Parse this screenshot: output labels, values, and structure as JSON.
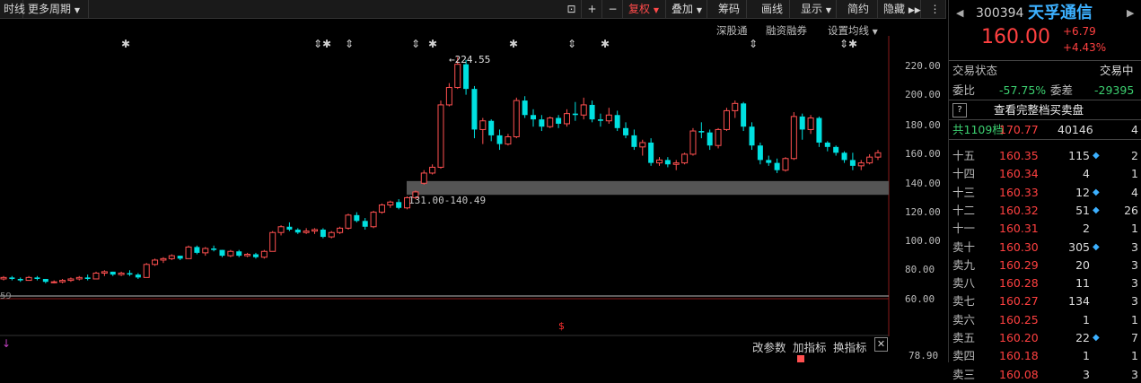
{
  "toolbar": {
    "period_partial": "时线",
    "more_periods": "更多周期",
    "adjust": "复权",
    "overlay": "叠加",
    "chips": "筹码",
    "draw_line": "画线",
    "display": "显示",
    "simple": "简约",
    "hide": "隐藏"
  },
  "subnav": {
    "sz_connect": "深股通",
    "margin": "融资融券",
    "ma_settings": "设置均线"
  },
  "chart": {
    "peak_label": "224.55",
    "band_label": "131.00-140.49",
    "y_ticks": [
      "220.00",
      "200.00",
      "180.00",
      "160.00",
      "140.00",
      "120.00",
      "100.00",
      "80.00",
      "60.00"
    ],
    "bottom_value": "78.90",
    "left_edge_value": "59"
  },
  "chart_data": {
    "type": "candlestick",
    "ylim": [
      55,
      232
    ],
    "support_band": [
      131.0,
      140.49
    ],
    "candles": [
      [
        73,
        75,
        72,
        74
      ],
      [
        74,
        75,
        72,
        73
      ],
      [
        73,
        74,
        71,
        72
      ],
      [
        72,
        75,
        72,
        74
      ],
      [
        74,
        75,
        72,
        73
      ],
      [
        73,
        73,
        70,
        71
      ],
      [
        71,
        72,
        70,
        71
      ],
      [
        71,
        73,
        70,
        72
      ],
      [
        72,
        74,
        71,
        73
      ],
      [
        73,
        75,
        72,
        74
      ],
      [
        74,
        76,
        72,
        73
      ],
      [
        73,
        78,
        73,
        77
      ],
      [
        77,
        79,
        75,
        78
      ],
      [
        78,
        78,
        75,
        76
      ],
      [
        76,
        78,
        75,
        77
      ],
      [
        77,
        79,
        75,
        76
      ],
      [
        76,
        77,
        73,
        74
      ],
      [
        74,
        84,
        74,
        83
      ],
      [
        83,
        87,
        82,
        86
      ],
      [
        86,
        88,
        84,
        87
      ],
      [
        87,
        90,
        86,
        89
      ],
      [
        89,
        89,
        86,
        87
      ],
      [
        87,
        96,
        87,
        95
      ],
      [
        95,
        96,
        90,
        91
      ],
      [
        91,
        95,
        89,
        94
      ],
      [
        94,
        96,
        92,
        93
      ],
      [
        93,
        93,
        88,
        89
      ],
      [
        89,
        93,
        88,
        92
      ],
      [
        92,
        93,
        88,
        89
      ],
      [
        89,
        91,
        88,
        90
      ],
      [
        90,
        91,
        87,
        88
      ],
      [
        88,
        93,
        87,
        92
      ],
      [
        92,
        106,
        92,
        105
      ],
      [
        105,
        110,
        103,
        109
      ],
      [
        109,
        112,
        106,
        107
      ],
      [
        107,
        108,
        104,
        105
      ],
      [
        105,
        108,
        104,
        106
      ],
      [
        106,
        108,
        104,
        107
      ],
      [
        107,
        108,
        101,
        102
      ],
      [
        102,
        106,
        101,
        105
      ],
      [
        105,
        109,
        104,
        108
      ],
      [
        108,
        118,
        107,
        117
      ],
      [
        117,
        119,
        112,
        113
      ],
      [
        113,
        115,
        107,
        109
      ],
      [
        109,
        120,
        108,
        119
      ],
      [
        119,
        125,
        118,
        124
      ],
      [
        124,
        127,
        122,
        126
      ],
      [
        126,
        128,
        121,
        122
      ],
      [
        122,
        130,
        121,
        129
      ],
      [
        129,
        134,
        128,
        133
      ],
      [
        139,
        148,
        138,
        146
      ],
      [
        146,
        152,
        145,
        150
      ],
      [
        150,
        196,
        149,
        193
      ],
      [
        193,
        208,
        192,
        205
      ],
      [
        205,
        226,
        204,
        221
      ],
      [
        221,
        224,
        200,
        204
      ],
      [
        204,
        206,
        170,
        176
      ],
      [
        176,
        184,
        166,
        182
      ],
      [
        182,
        183,
        168,
        172
      ],
      [
        172,
        176,
        162,
        166
      ],
      [
        166,
        173,
        165,
        171
      ],
      [
        171,
        198,
        170,
        196
      ],
      [
        196,
        199,
        184,
        186
      ],
      [
        186,
        190,
        178,
        183
      ],
      [
        183,
        186,
        175,
        178
      ],
      [
        178,
        185,
        177,
        184
      ],
      [
        184,
        186,
        177,
        180
      ],
      [
        180,
        190,
        178,
        187
      ],
      [
        187,
        195,
        182,
        186
      ],
      [
        186,
        198,
        183,
        193
      ],
      [
        193,
        196,
        181,
        183
      ],
      [
        183,
        187,
        178,
        182
      ],
      [
        182,
        191,
        180,
        186
      ],
      [
        186,
        189,
        175,
        177
      ],
      [
        177,
        181,
        170,
        172
      ],
      [
        172,
        176,
        162,
        164
      ],
      [
        164,
        169,
        158,
        167
      ],
      [
        167,
        170,
        151,
        153
      ],
      [
        153,
        157,
        151,
        155
      ],
      [
        155,
        157,
        150,
        152
      ],
      [
        152,
        155,
        148,
        153
      ],
      [
        153,
        160,
        152,
        159
      ],
      [
        159,
        177,
        158,
        175
      ],
      [
        175,
        181,
        170,
        174
      ],
      [
        174,
        176,
        162,
        165
      ],
      [
        165,
        177,
        163,
        176
      ],
      [
        176,
        191,
        175,
        189
      ],
      [
        189,
        196,
        184,
        194
      ],
      [
        194,
        195,
        175,
        178
      ],
      [
        178,
        181,
        162,
        165
      ],
      [
        165,
        167,
        152,
        155
      ],
      [
        155,
        158,
        151,
        153
      ],
      [
        153,
        156,
        146,
        148
      ],
      [
        148,
        157,
        147,
        156
      ],
      [
        156,
        188,
        155,
        185
      ],
      [
        185,
        187,
        169,
        176
      ],
      [
        176,
        186,
        173,
        184
      ],
      [
        184,
        185,
        164,
        167
      ],
      [
        167,
        168,
        161,
        164
      ],
      [
        164,
        165,
        158,
        160
      ],
      [
        160,
        161,
        153,
        155
      ],
      [
        155,
        160,
        148,
        151
      ],
      [
        151,
        155,
        148,
        153
      ],
      [
        153,
        159,
        152,
        157
      ],
      [
        157,
        162,
        155,
        160
      ]
    ]
  },
  "quote": {
    "code": "300394",
    "name": "天孚通信",
    "price": "160.00",
    "change": "+6.79",
    "change_pct": "+4.43%",
    "status_label": "交易状态",
    "status_value": "交易中",
    "ratio_label": "委比",
    "ratio_value": "-57.75%",
    "diff_label": "委差",
    "diff_value": "-29395",
    "help_icon_text": "?",
    "full_book_label": "查看完整档买卖盘",
    "total_label": "共1109档",
    "total_price": "170.77",
    "total_volume": "40146",
    "total_count": "4"
  },
  "order_book": [
    {
      "level": "十五",
      "price": "160.35",
      "volume": "115",
      "marker": true,
      "count": "2"
    },
    {
      "level": "十四",
      "price": "160.34",
      "volume": "4",
      "marker": false,
      "count": "1"
    },
    {
      "level": "十三",
      "price": "160.33",
      "volume": "12",
      "marker": true,
      "count": "4"
    },
    {
      "level": "十二",
      "price": "160.32",
      "volume": "51",
      "marker": true,
      "count": "26"
    },
    {
      "level": "十一",
      "price": "160.31",
      "volume": "2",
      "marker": false,
      "count": "1"
    },
    {
      "level": "卖十",
      "price": "160.30",
      "volume": "305",
      "marker": true,
      "count": "3"
    },
    {
      "level": "卖九",
      "price": "160.29",
      "volume": "20",
      "marker": false,
      "count": "3"
    },
    {
      "level": "卖八",
      "price": "160.28",
      "volume": "11",
      "marker": false,
      "count": "3"
    },
    {
      "level": "卖七",
      "price": "160.27",
      "volume": "134",
      "marker": false,
      "count": "3"
    },
    {
      "level": "卖六",
      "price": "160.25",
      "volume": "1",
      "marker": false,
      "count": "1"
    },
    {
      "level": "卖五",
      "price": "160.20",
      "volume": "22",
      "marker": true,
      "count": "7"
    },
    {
      "level": "卖四",
      "price": "160.18",
      "volume": "1",
      "marker": false,
      "count": "1"
    },
    {
      "level": "卖三",
      "price": "160.08",
      "volume": "3",
      "marker": false,
      "count": "3"
    }
  ],
  "bottom": {
    "modify_params": "改参数",
    "add_indicator": "加指标",
    "switch_indicator": "换指标"
  },
  "colors": {
    "up": "#ff5050",
    "down": "#00e0e0",
    "band": "#555555",
    "name": "#3cb0ff"
  }
}
